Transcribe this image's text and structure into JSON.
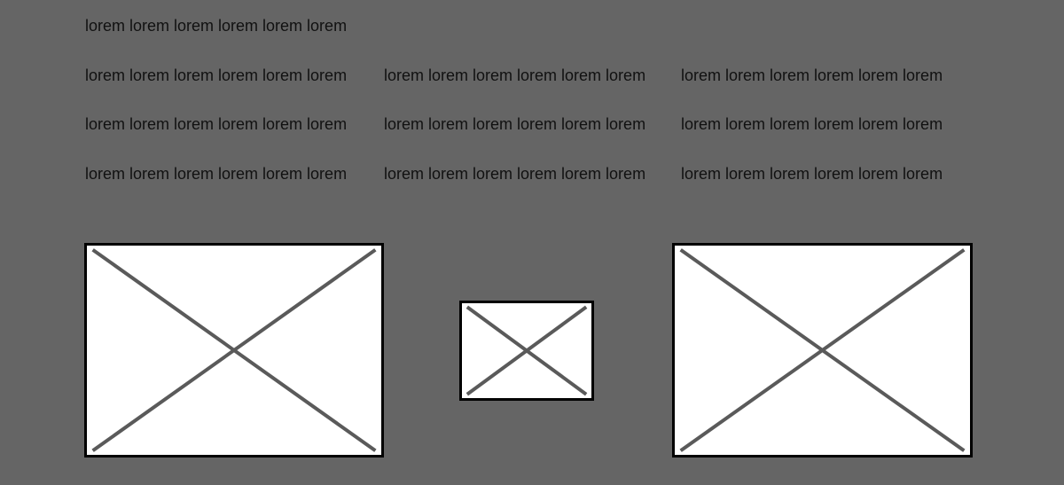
{
  "text_rows": [
    [
      "lorem lorem lorem lorem lorem lorem"
    ],
    [
      "lorem lorem lorem lorem lorem lorem",
      "lorem lorem lorem lorem lorem lorem",
      "lorem lorem lorem lorem lorem lorem"
    ],
    [
      "lorem lorem lorem lorem lorem lorem",
      "lorem lorem lorem lorem lorem lorem",
      "lorem lorem lorem lorem lorem lorem"
    ],
    [
      "lorem lorem lorem lorem lorem lorem",
      "lorem lorem lorem lorem lorem lorem",
      "lorem lorem lorem lorem lorem lorem"
    ]
  ],
  "colors": {
    "background": "#656565",
    "text": "#111111",
    "placeholder_fill": "#ffffff",
    "placeholder_border": "#000000",
    "placeholder_cross": "#5a5a5a"
  },
  "image_placeholders": [
    "image-placeholder",
    "image-placeholder",
    "image-placeholder"
  ]
}
